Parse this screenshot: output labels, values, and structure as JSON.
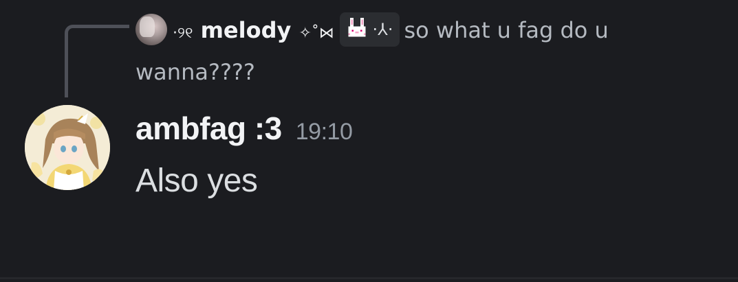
{
  "reply": {
    "avatar_icon": "user-avatar",
    "author_prefix": "·୨୧",
    "author_name": "melody",
    "author_suffix": "✧˚⋈",
    "emoji_chip_text": "·⅄·",
    "emoji_icon": "pink-bunny-emoji",
    "text": "so what u fag do u wanna????"
  },
  "message": {
    "author": "ambfag :3",
    "timestamp": "19:10",
    "content": "Also yes",
    "avatar_icon": "anime-girl-avatar"
  },
  "colors": {
    "background": "#1b1c20",
    "author": "#f2f3f5",
    "timestamp": "#949ba4",
    "content": "#dbdee1",
    "reply_text": "#b5bac1",
    "chip_bg": "#2b2d31",
    "spine": "#4e5058"
  }
}
